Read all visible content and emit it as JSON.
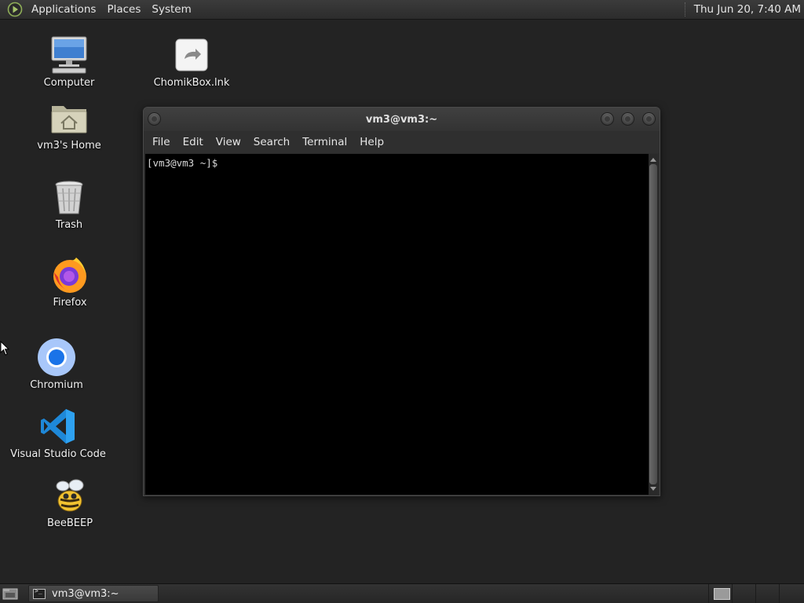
{
  "top_panel": {
    "menus": [
      "Applications",
      "Places",
      "System"
    ],
    "clock": "Thu Jun 20,  7:40 AM"
  },
  "desktop_icons": [
    {
      "label": "Computer",
      "icon": "computer-icon"
    },
    {
      "label": "ChomikBox.lnk",
      "icon": "shortcut-file-icon"
    },
    {
      "label": "vm3's Home",
      "icon": "home-folder-icon"
    },
    {
      "label": "Trash",
      "icon": "trash-icon"
    },
    {
      "label": "Firefox",
      "icon": "firefox-icon"
    },
    {
      "label": "Chromium",
      "icon": "chromium-icon"
    },
    {
      "label": "Visual Studio Code",
      "icon": "vscode-icon"
    },
    {
      "label": "BeeBEEP",
      "icon": "beebeep-icon"
    }
  ],
  "terminal": {
    "title": "vm3@vm3:~",
    "menu": [
      "File",
      "Edit",
      "View",
      "Search",
      "Terminal",
      "Help"
    ],
    "prompt": "[vm3@vm3 ~]$"
  },
  "taskbar": {
    "tasks": [
      {
        "label": "vm3@vm3:~",
        "icon": "terminal-icon"
      }
    ]
  }
}
